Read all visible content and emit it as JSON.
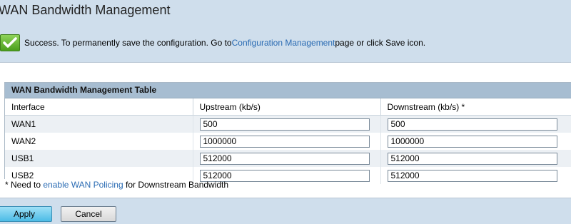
{
  "page": {
    "title": "WAN Bandwidth Management"
  },
  "success": {
    "icon": "check-icon",
    "prefix": "Success. To permanently save the configuration. Go to ",
    "link_text": "Configuration Management",
    "suffix": " page or click Save icon."
  },
  "table": {
    "title": "WAN Bandwidth Management Table",
    "columns": [
      "Interface",
      "Upstream (kb/s)",
      "Downstream (kb/s) *"
    ],
    "rows": [
      {
        "interface": "WAN1",
        "upstream": "500",
        "downstream": "500"
      },
      {
        "interface": "WAN2",
        "upstream": "1000000",
        "downstream": "1000000"
      },
      {
        "interface": "USB1",
        "upstream": "512000",
        "downstream": "512000"
      },
      {
        "interface": "USB2",
        "upstream": "512000",
        "downstream": "512000"
      }
    ]
  },
  "footnote": {
    "prefix": "* Need to ",
    "link_text": "enable WAN Policing",
    "suffix": " for Downstream Bandwidth"
  },
  "buttons": {
    "apply": "Apply",
    "cancel": "Cancel"
  },
  "colors": {
    "link": "#2a6bb3",
    "apply_button": "#4cbbe6",
    "band": "#cfdeec",
    "table_header": "#a7bdd1"
  }
}
